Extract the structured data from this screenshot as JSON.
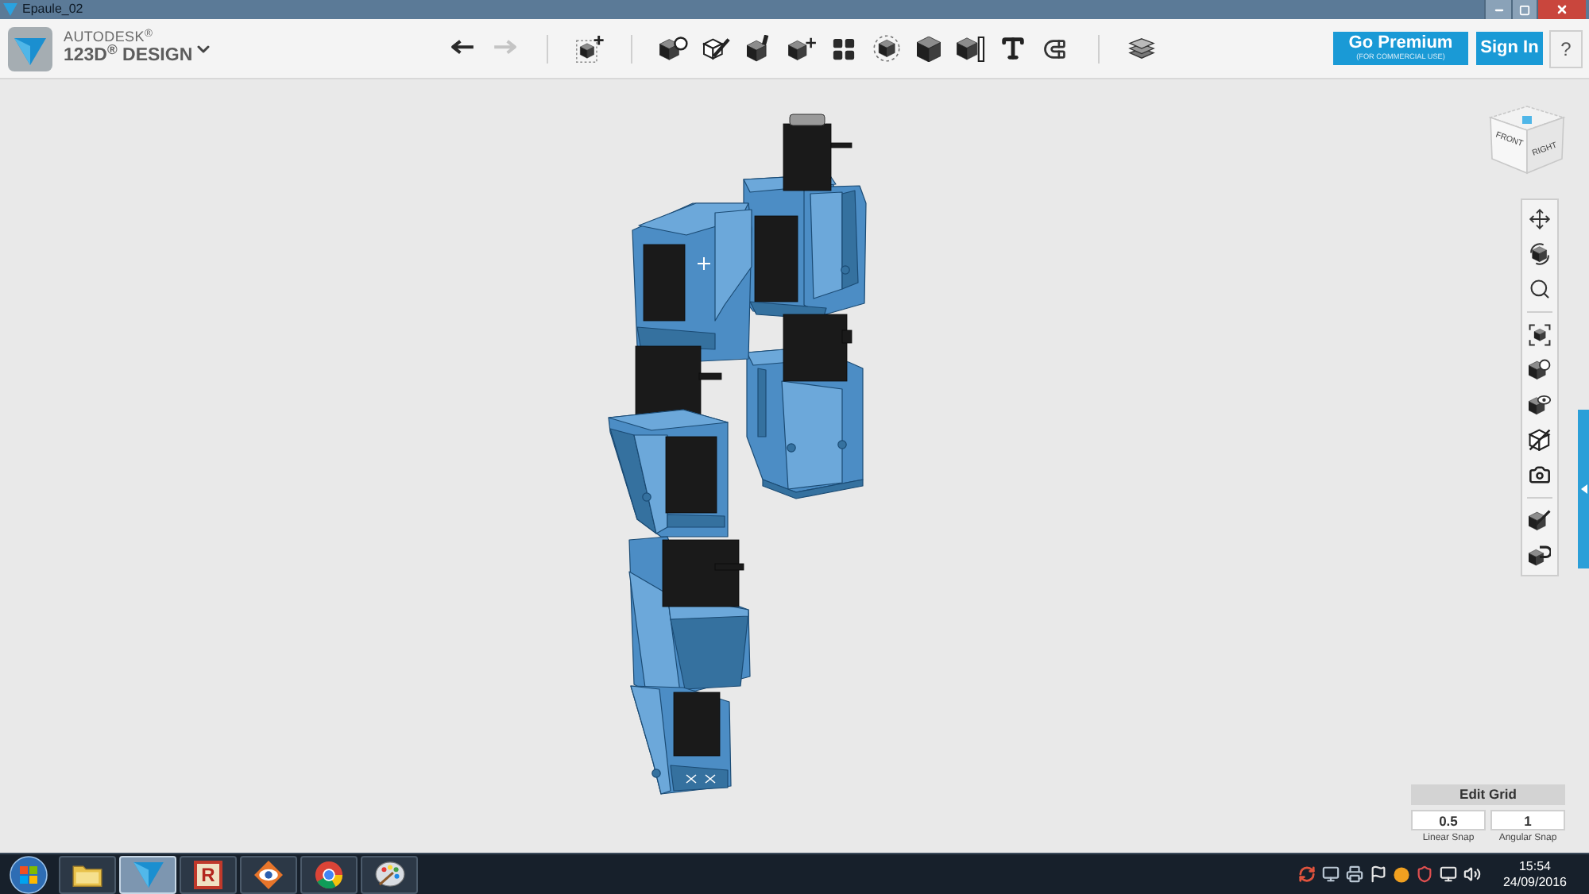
{
  "window": {
    "title": "Epaule_02"
  },
  "header": {
    "brand": "AUTODESK$^{®}$",
    "product": "123D$^{®}$ DESIGN"
  },
  "toolbar": {
    "history": [
      {
        "kind": "undo",
        "disabled": false
      },
      {
        "kind": "redo",
        "disabled": true
      }
    ]
  },
  "account": {
    "premium_button": {
      "label": "Go Premium",
      "note": "(FOR COMMERCIAL USE)"
    },
    "sign_in_button": "Sign In",
    "help_button": "?"
  },
  "view_cube": {
    "faces": [
      "FRONT",
      "RIGHT"
    ]
  },
  "grid_panel": {
    "title": "Edit Grid",
    "fields": [
      {
        "value": "0.5",
        "label": "Linear Snap"
      },
      {
        "value": "1",
        "label": "Angular Snap"
      }
    ]
  },
  "taskbar": {
    "apps": [
      {
        "kind": "folder",
        "selected": false
      },
      {
        "kind": "design_app",
        "selected": true
      },
      {
        "kind": "letter_tile",
        "letter": "R",
        "selected": false
      },
      {
        "kind": "eye",
        "selected": false
      },
      {
        "kind": "browser",
        "selected": false
      },
      {
        "kind": "paint",
        "selected": false
      }
    ],
    "clock": {
      "time": "15:54",
      "date": "24/09/2016"
    }
  }
}
